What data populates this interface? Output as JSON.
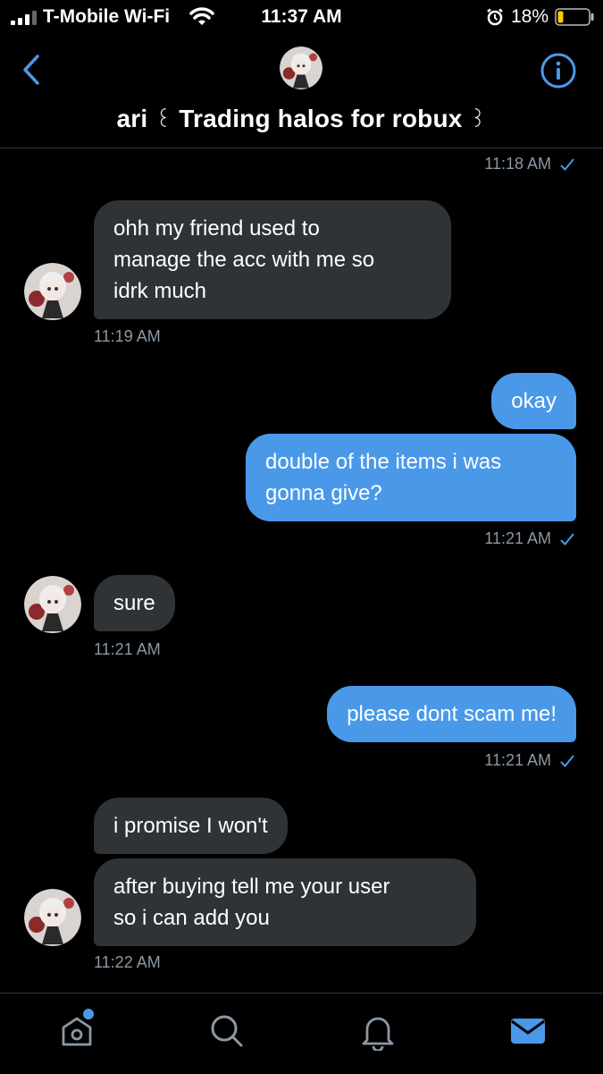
{
  "status_bar": {
    "carrier": "T-Mobile Wi-Fi",
    "time": "11:37 AM",
    "battery_pct": "18%",
    "battery_level": 0.18,
    "battery_color": "#ffcc00"
  },
  "header": {
    "title_name": "ari",
    "title_deco_left": "꒰",
    "title_main": "Trading halos for robux",
    "title_deco_right": "꒱",
    "accent": "#4a99e9"
  },
  "conversation": {
    "ts0": "11:18 AM",
    "m1": {
      "lines": [
        "ohh my friend used to",
        "manage the acc with me so",
        "idrk much"
      ],
      "time": "11:19 AM"
    },
    "m2": "okay",
    "m3": {
      "lines": [
        "double of the items i was",
        "gonna give?"
      ],
      "time": "11:21 AM"
    },
    "m4": {
      "text": "sure",
      "time": "11:21 AM"
    },
    "m5": {
      "text": "please dont scam me!",
      "time": "11:21 AM"
    },
    "m6": "i promise I won't",
    "m7": {
      "lines": [
        "after buying tell me your user",
        "so i can add you"
      ],
      "time": "11:22 AM"
    }
  },
  "colors": {
    "incoming_bubble": "#2f3336",
    "outgoing_bubble": "#4a99e9",
    "timestamp": "#8b98a5"
  },
  "tabs": [
    {
      "icon": "home-icon",
      "active": false,
      "badge": true
    },
    {
      "icon": "search-icon",
      "active": false
    },
    {
      "icon": "notifications-icon",
      "active": false
    },
    {
      "icon": "messages-icon",
      "active": true
    }
  ]
}
